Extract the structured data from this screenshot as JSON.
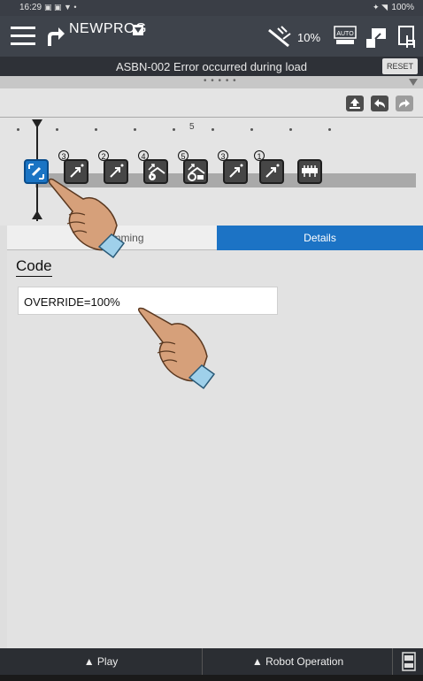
{
  "statusbar": {
    "time": "16:29",
    "battery": "100%"
  },
  "topbar": {
    "program_name": "NEWPROG",
    "override_speed": "10%",
    "auto_label": "AUTO"
  },
  "errorbar": {
    "message": "ASBN-002  Error occurred during load",
    "reset_label": "RESET"
  },
  "handle": {
    "dots": "• • • • •"
  },
  "ruler": {
    "mark_five": "5"
  },
  "commands": [
    {
      "icon": "edit-icon",
      "badge": ""
    },
    {
      "icon": "joint-move-icon",
      "badge": "3"
    },
    {
      "icon": "joint-move-icon",
      "badge": "2"
    },
    {
      "icon": "palette-call-icon",
      "badge": "4"
    },
    {
      "icon": "palette-call-icon",
      "badge": "5"
    },
    {
      "icon": "joint-move-icon",
      "badge": "3"
    },
    {
      "icon": "joint-move-icon",
      "badge": "1"
    },
    {
      "icon": "end-block-icon",
      "badge": ""
    }
  ],
  "tabs": {
    "programming": "Programming",
    "details": "Details"
  },
  "content": {
    "code_label": "Code",
    "code_value": "OVERRIDE=100%"
  },
  "bottombar": {
    "play": "▲ Play",
    "robot_operation": "▲ Robot Operation"
  },
  "colors": {
    "accent": "#1c73c5",
    "topbar": "#3e434b"
  }
}
